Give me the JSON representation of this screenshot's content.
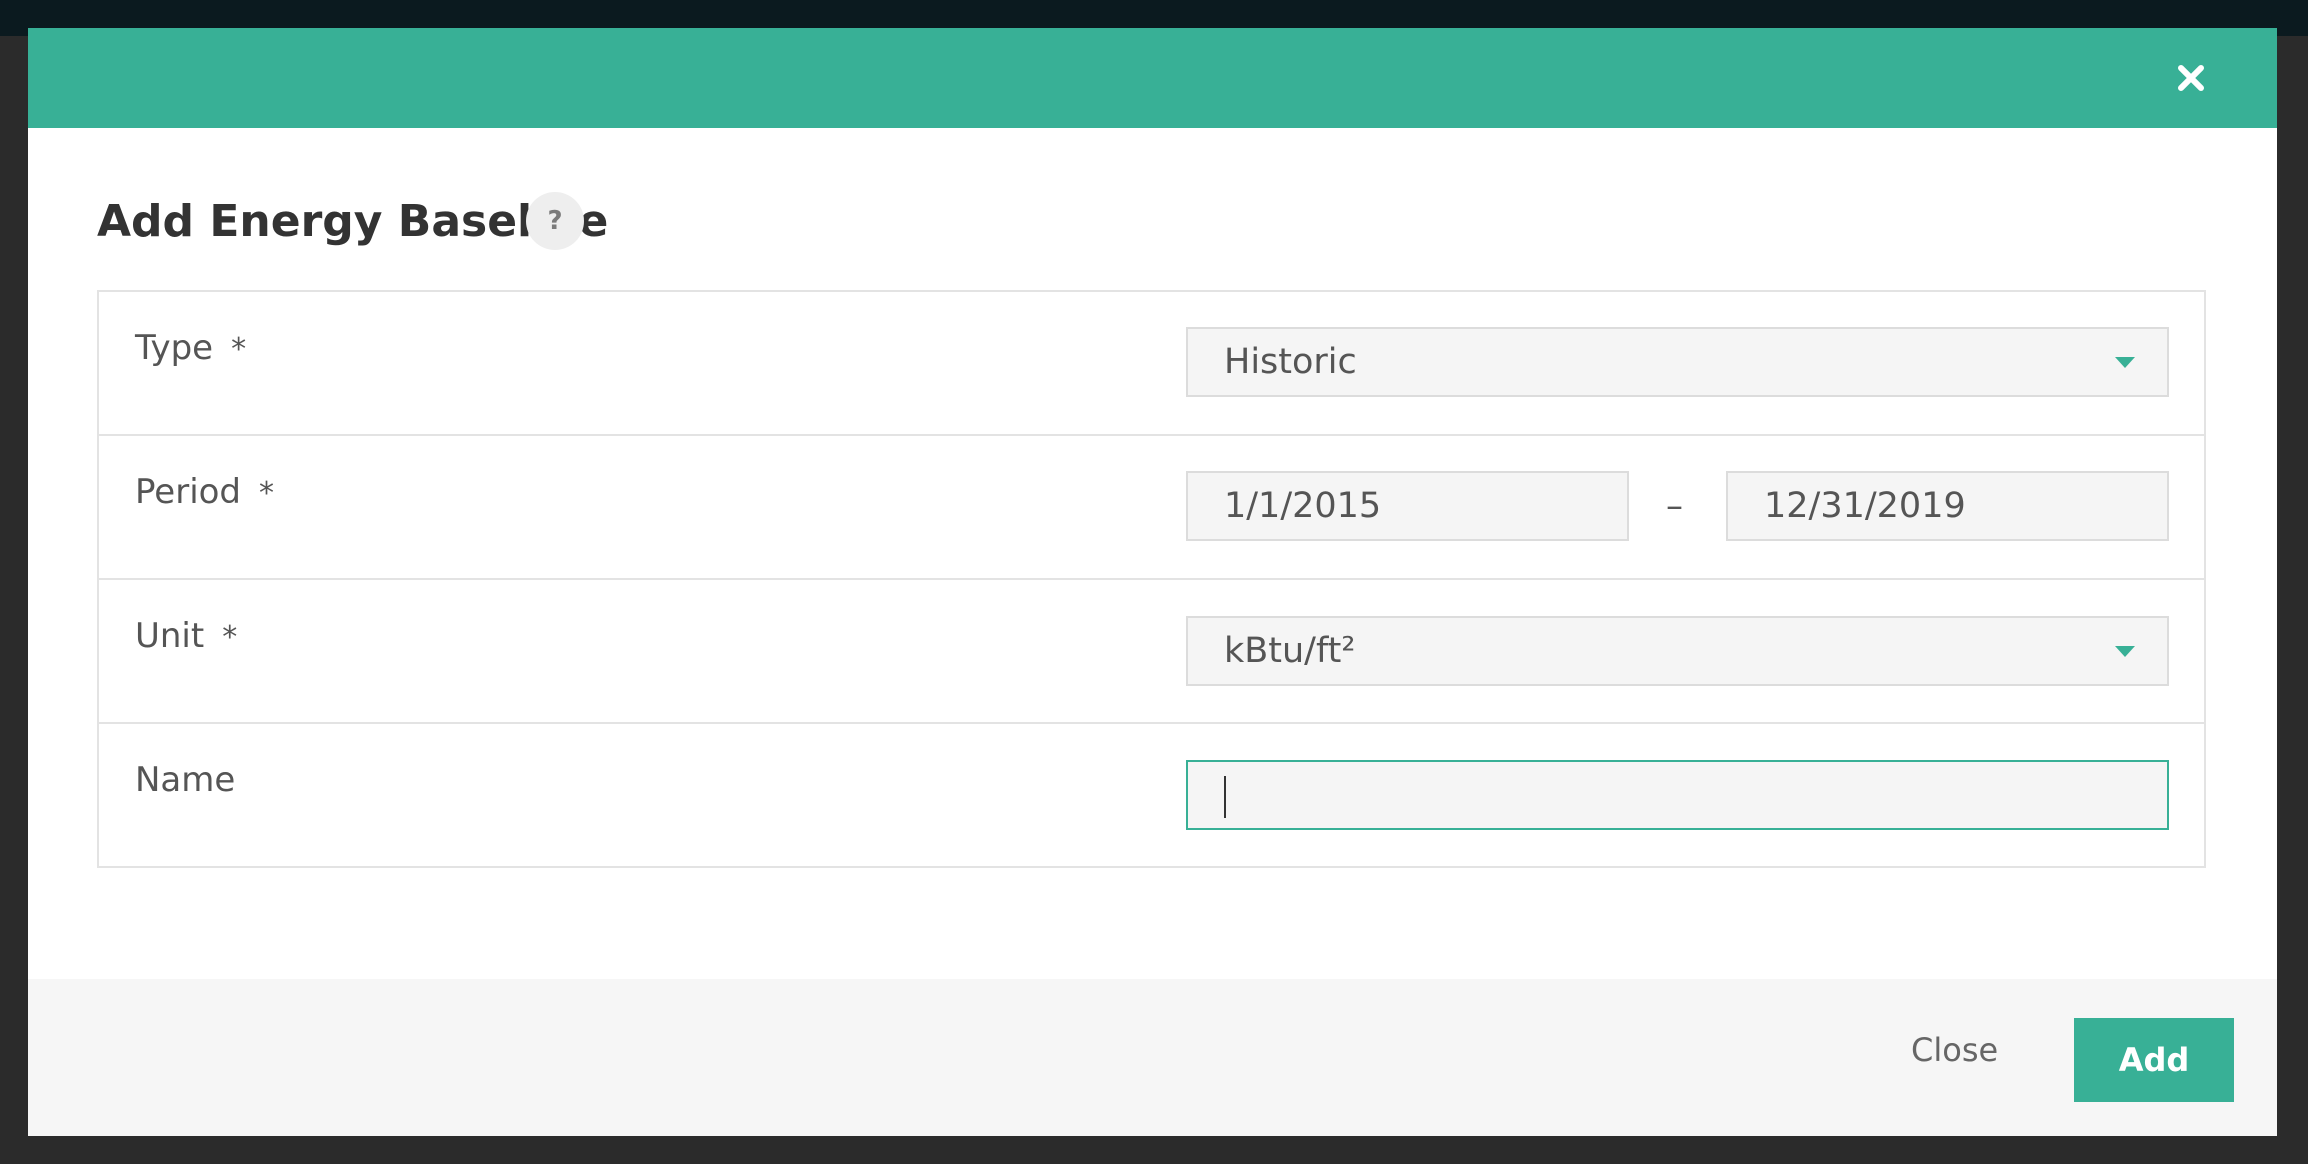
{
  "dialog": {
    "title": "Add Energy Baseline",
    "help_icon": "?",
    "close_icon": "close-icon"
  },
  "form": {
    "type": {
      "label": "Type",
      "required_mark": "*",
      "value": "Historic"
    },
    "period": {
      "label": "Period",
      "required_mark": "*",
      "start": "1/1/2015",
      "separator": "–",
      "end": "12/31/2019"
    },
    "unit": {
      "label": "Unit",
      "required_mark": "*",
      "value": "kBtu/ft²"
    },
    "name": {
      "label": "Name",
      "value": ""
    }
  },
  "footer": {
    "close_label": "Close",
    "add_label": "Add"
  },
  "colors": {
    "accent": "#38b096",
    "backdrop": "#2b2b2b",
    "top_strip": "#0b1a1f"
  }
}
